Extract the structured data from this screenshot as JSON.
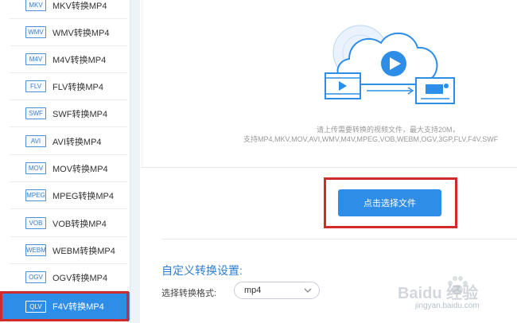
{
  "sidebar": {
    "items": [
      {
        "badge": "MKV",
        "label": "MKV转换MP4"
      },
      {
        "badge": "WMV",
        "label": "WMV转换MP4"
      },
      {
        "badge": "M4V",
        "label": "M4V转换MP4"
      },
      {
        "badge": "FLV",
        "label": "FLV转换MP4"
      },
      {
        "badge": "SWF",
        "label": "SWF转换MP4"
      },
      {
        "badge": "AVI",
        "label": "AVI转换MP4"
      },
      {
        "badge": "MOV",
        "label": "MOV转换MP4"
      },
      {
        "badge": "MPEG",
        "label": "MPEG转换MP4"
      },
      {
        "badge": "VOB",
        "label": "VOB转换MP4"
      },
      {
        "badge": "WEBM",
        "label": "WEBM转换MP4"
      },
      {
        "badge": "OGV",
        "label": "OGV转换MP4"
      },
      {
        "badge": "QLV",
        "label": "F4V转换MP4"
      }
    ]
  },
  "upload": {
    "hint_line1": "请上传需要转换的视频文件，最大支持20M，",
    "hint_line2": "支持MP4,MKV,MOV,AVI,WMV,M4V,MPEG,VOB,WEBM,OGV,3GP,FLV,F4V,SWF",
    "select_button": "点击选择文件"
  },
  "settings": {
    "title": "自定义转换设置:",
    "format_label": "选择转换格式:",
    "format_value": "mp4"
  },
  "watermark": {
    "text": "Baidu 经验",
    "sub": "jingyan.baidu.com"
  },
  "colors": {
    "accent": "#2e8de6",
    "highlight_frame": "#d12a2a"
  }
}
